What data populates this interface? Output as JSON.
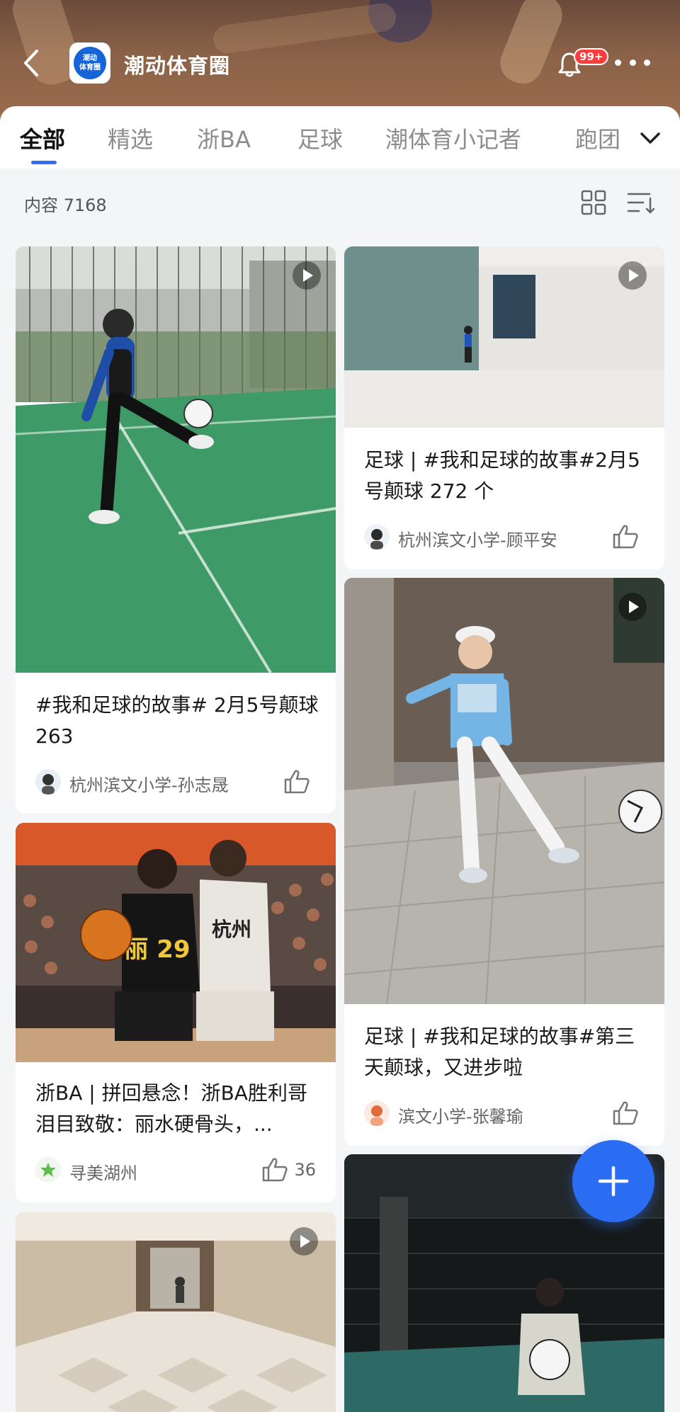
{
  "header": {
    "title": "潮动体育圈",
    "logo_lines": [
      "潮动",
      "体育圈"
    ],
    "notification_badge": "99+"
  },
  "tabs": [
    {
      "label": "全部",
      "active": true
    },
    {
      "label": "精选",
      "active": false
    },
    {
      "label": "浙BA",
      "active": false
    },
    {
      "label": "足球",
      "active": false
    },
    {
      "label": "潮体育小记者",
      "active": false
    },
    {
      "label": "跑团",
      "active": false
    }
  ],
  "content": {
    "count_label": "内容 7168"
  },
  "cards": [
    {
      "title": "#我和足球的故事# 2月5号颠球 263",
      "author": "杭州滨文小学-孙志晟",
      "likes": "",
      "has_video": true
    },
    {
      "title": "浙BA | 拼回悬念！浙BA胜利哥泪目致敬：丽水硬骨头，...",
      "author": "寻美湖州",
      "likes": "36",
      "has_video": false
    },
    {
      "title": "",
      "author": "",
      "likes": "",
      "has_video": true
    },
    {
      "title": "足球 | #我和足球的故事#2月5号颠球 272 个",
      "author": "杭州滨文小学-顾平安",
      "likes": "",
      "has_video": true
    },
    {
      "title": "足球 | #我和足球的故事#第三天颠球，又进步啦",
      "author": "滨文小学-张馨瑜",
      "likes": "",
      "has_video": true
    },
    {
      "title": "",
      "author": "",
      "likes": "",
      "has_video": false
    }
  ],
  "colors": {
    "accent": "#2f6df6",
    "fab": "#2a6cf2",
    "badge": "#ff3b3b"
  },
  "icons": {
    "back": "back-arrow-icon",
    "bell": "bell-icon",
    "more": "more-dots-icon",
    "expand": "chevron-down-icon",
    "grid": "grid-view-icon",
    "sort": "sort-icon",
    "play": "play-icon",
    "like": "thumbs-up-icon",
    "add": "plus-icon"
  }
}
